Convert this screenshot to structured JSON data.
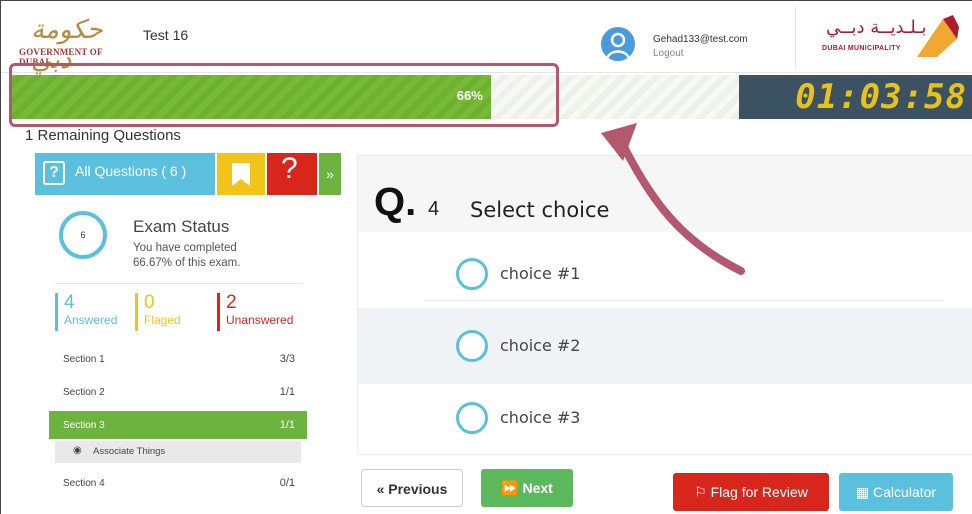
{
  "header": {
    "gov_logo_arabic": "حكومة دبي",
    "gov_logo_english": "GOVERNMENT OF DUBAI",
    "exam_title": "Test 16",
    "user_email": "Gehad133@test.com",
    "logout_label": "Logout",
    "dm_logo_arabic": "بـلـديــة دبــي",
    "dm_logo_english": "DUBAI MUNICIPALITY"
  },
  "progress": {
    "percent": 66,
    "label": "66%"
  },
  "timer": {
    "value": "01:03:58"
  },
  "remaining_label": "1 Remaining Questions",
  "tabs": {
    "all_questions_label": "All Questions ( 6 )",
    "help_glyph": "?",
    "more_glyph": "»"
  },
  "exam_status": {
    "circle_value": "6",
    "title": "Exam Status",
    "line1": "You have completed",
    "line2": "66.67% of this exam.",
    "answered_count": "4",
    "answered_label": "Answered",
    "flagged_count": "0",
    "flagged_label": "Flaged",
    "unanswered_count": "2",
    "unanswered_label": "Unanswered"
  },
  "sections": [
    {
      "name": "Section 1",
      "count": "3/3"
    },
    {
      "name": "Section 2",
      "count": "1/1"
    },
    {
      "name": "Section 3",
      "count": "1/1"
    },
    {
      "name": "Section 4",
      "count": "0/1"
    }
  ],
  "subsection": {
    "name": "Associate Things"
  },
  "question": {
    "prefix": "Q.",
    "number": "4",
    "text": "Select choice",
    "choices": [
      "choice #1",
      "choice #2",
      "choice #3"
    ]
  },
  "buttons": {
    "previous": "« Previous",
    "next": "⏩ Next",
    "flag": "⚐ Flag for Review",
    "calculator": "▦ Calculator"
  },
  "colors": {
    "progress_green": "#6db22f",
    "accent_blue": "#5bc0de",
    "flag_yellow": "#f0c419",
    "alert_red": "#d9261c",
    "timer_bg": "#3b5263",
    "timer_digits": "#e8c21a",
    "annotation": "#b4586f"
  }
}
